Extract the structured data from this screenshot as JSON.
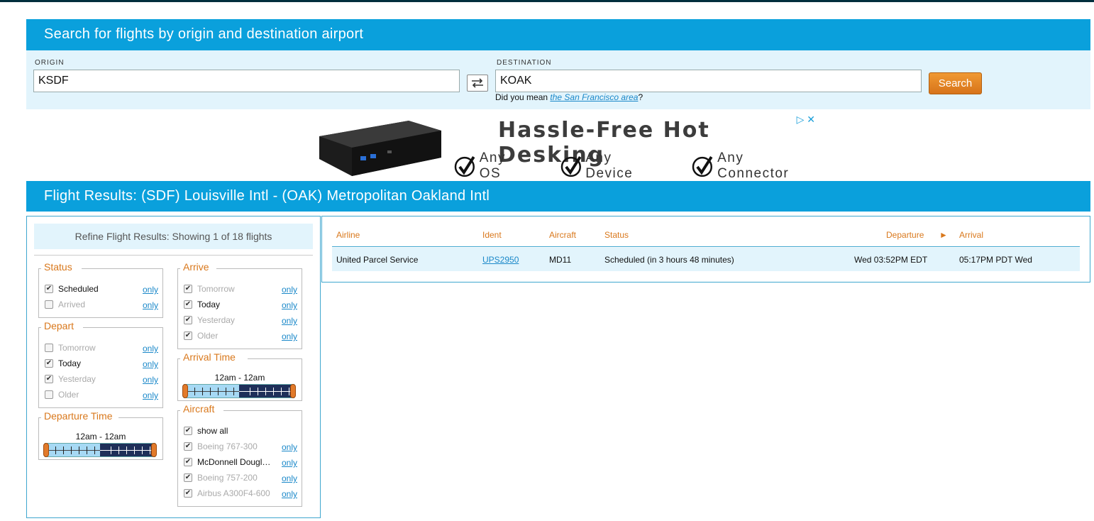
{
  "search": {
    "header": "Search for flights by origin and destination airport",
    "origin_label": "ORIGIN",
    "origin_value": "KSDF",
    "destination_label": "DESTINATION",
    "destination_value": "KOAK",
    "suggest_prefix": "Did you mean ",
    "suggest_link": "the San Francisco area",
    "suggest_suffix": "?",
    "search_button": "Search"
  },
  "ad": {
    "title": "Hassle-Free Hot Desking",
    "features": [
      "Any OS",
      "Any Device",
      "Any Connector"
    ],
    "choices": "▷ ✕"
  },
  "results_header": "Flight Results: (SDF) Louisville Intl - (OAK) Metropolitan Oakland Intl",
  "refine": {
    "title": "Refine Flight Results: Showing 1 of 18 flights",
    "only_label": "only",
    "status": {
      "title": "Status",
      "items": [
        {
          "label": "Scheduled",
          "checked": true,
          "dim": false
        },
        {
          "label": "Arrived",
          "checked": false,
          "dim": true
        }
      ]
    },
    "depart": {
      "title": "Depart",
      "items": [
        {
          "label": "Tomorrow",
          "checked": false,
          "dim": true
        },
        {
          "label": "Today",
          "checked": true,
          "dim": false
        },
        {
          "label": "Yesterday",
          "checked": true,
          "dim": true
        },
        {
          "label": "Older",
          "checked": false,
          "dim": true
        }
      ]
    },
    "departure_time": {
      "title": "Departure Time",
      "range": "12am - 12am"
    },
    "arrive": {
      "title": "Arrive",
      "items": [
        {
          "label": "Tomorrow",
          "checked": true,
          "dim": true
        },
        {
          "label": "Today",
          "checked": true,
          "dim": false
        },
        {
          "label": "Yesterday",
          "checked": true,
          "dim": true
        },
        {
          "label": "Older",
          "checked": true,
          "dim": true
        }
      ]
    },
    "arrival_time": {
      "title": "Arrival Time",
      "range": "12am - 12am"
    },
    "aircraft": {
      "title": "Aircraft",
      "show_all": "show all",
      "items": [
        {
          "label": "Boeing 767-300",
          "checked": true,
          "dim": true
        },
        {
          "label": "McDonnell Dougl…",
          "checked": true,
          "dim": false
        },
        {
          "label": "Boeing 757-200",
          "checked": true,
          "dim": true
        },
        {
          "label": "Airbus A300F4-600",
          "checked": true,
          "dim": true
        }
      ]
    }
  },
  "table": {
    "headers": {
      "airline": "Airline",
      "ident": "Ident",
      "aircraft": "Aircraft",
      "status": "Status",
      "departure": "Departure",
      "arrow": "►",
      "arrival": "Arrival"
    },
    "rows": [
      {
        "airline": "United Parcel Service",
        "ident": "UPS2950",
        "aircraft": "MD11",
        "status": "Scheduled (in 3 hours 48 minutes)",
        "departure": "Wed 03:52PM EDT",
        "arrival": "05:17PM PDT Wed"
      }
    ]
  }
}
